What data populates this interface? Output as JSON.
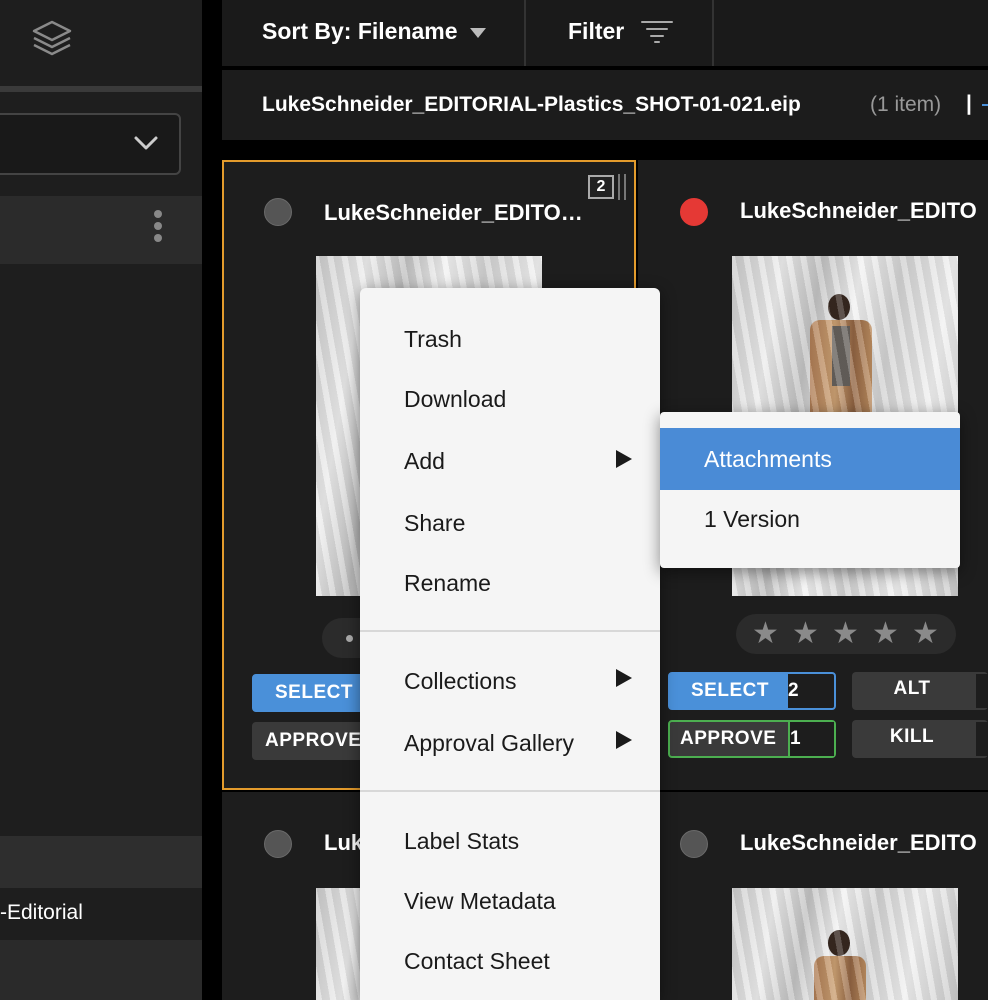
{
  "sidebar": {
    "icons": {
      "layers": "layers-icon",
      "dropdown": "chevron-down-icon",
      "menu": "kebab-menu-icon"
    },
    "select_value": "",
    "item_label": "-Editorial"
  },
  "toolbar": {
    "sort_label": "Sort By: Filename",
    "filter_label": "Filter"
  },
  "breadcrumb": {
    "filename": "LukeSchneider_EDITORIAL-Plastics_SHOT-01-021.eip",
    "count": "(1 item)",
    "separator": "|"
  },
  "cards": [
    {
      "title": "LukeSchneider_EDITO…",
      "version_badge": "2",
      "label_color": "gray",
      "select_label": "SELECT",
      "approve_label": "APPROVE",
      "selected": true
    },
    {
      "title": "LukeSchneider_EDITO",
      "label_color": "#e53935",
      "rating_stars": 5,
      "star_glyph": "★",
      "select_label": "SELECT",
      "select_count": "2",
      "approve_label": "APPROVE",
      "approve_count": "1",
      "alt_label": "ALT",
      "kill_label": "KILL"
    },
    {
      "title": "Luk",
      "label_color": "gray"
    },
    {
      "title": "LukeSchneider_EDITO",
      "label_color": "gray"
    }
  ],
  "context_menu": {
    "items": [
      "Trash",
      "Download",
      "Add",
      "Share",
      "Rename"
    ],
    "group2": [
      "Collections",
      "Approval Gallery"
    ],
    "group3": [
      "Label Stats",
      "View Metadata",
      "Contact Sheet"
    ]
  },
  "submenu": {
    "items": [
      "Attachments",
      "1 Version"
    ],
    "highlighted": "Attachments"
  },
  "colors": {
    "accent_blue": "#4a90d9",
    "selected_border": "#e39b2c",
    "approve_border": "#4caf50",
    "red_label": "#e53935"
  }
}
